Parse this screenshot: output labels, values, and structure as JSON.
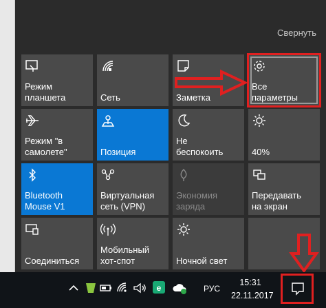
{
  "action_center": {
    "collapse_label": "Свернуть",
    "tiles": [
      {
        "label": "Режим\nпланшета",
        "icon": "tablet-mode-icon",
        "state": "normal"
      },
      {
        "label": "Сеть",
        "icon": "network-icon",
        "state": "normal"
      },
      {
        "label": "Заметка",
        "icon": "note-icon",
        "state": "normal"
      },
      {
        "label": "Все\nпараметры",
        "icon": "settings-gear-icon",
        "state": "highlighted"
      },
      {
        "label": "Режим \"в\nсамолете\"",
        "icon": "airplane-icon",
        "state": "normal"
      },
      {
        "label": "Позиция",
        "icon": "location-icon",
        "state": "active"
      },
      {
        "label": "Не\nбеспокоить",
        "icon": "moon-icon",
        "state": "normal"
      },
      {
        "label": "40%",
        "icon": "brightness-icon",
        "state": "normal"
      },
      {
        "label": "Bluetooth\nMouse V1",
        "icon": "bluetooth-icon",
        "state": "active"
      },
      {
        "label": "Виртуальная\nсеть (VPN)",
        "icon": "vpn-icon",
        "state": "normal"
      },
      {
        "label": "Экономия\nзаряда",
        "icon": "battery-saver-icon",
        "state": "disabled"
      },
      {
        "label": "Передавать\nна экран",
        "icon": "project-icon",
        "state": "normal"
      },
      {
        "label": "Соединиться",
        "icon": "connect-icon",
        "state": "normal"
      },
      {
        "label": "Мобильный\nхот-спот",
        "icon": "hotspot-icon",
        "state": "normal"
      },
      {
        "label": "Ночной свет",
        "icon": "night-light-icon",
        "state": "normal"
      },
      {
        "label": "",
        "icon": "",
        "state": "normal"
      }
    ]
  },
  "taskbar": {
    "language": "РУС",
    "time": "15:31",
    "date": "22.11.2017"
  },
  "colors": {
    "panel_bg": "#2b2b2b",
    "tile_bg": "#4a4a4a",
    "tile_active": "#0a78d4",
    "highlight_red": "#e02020",
    "taskbar_bg": "#101418"
  }
}
